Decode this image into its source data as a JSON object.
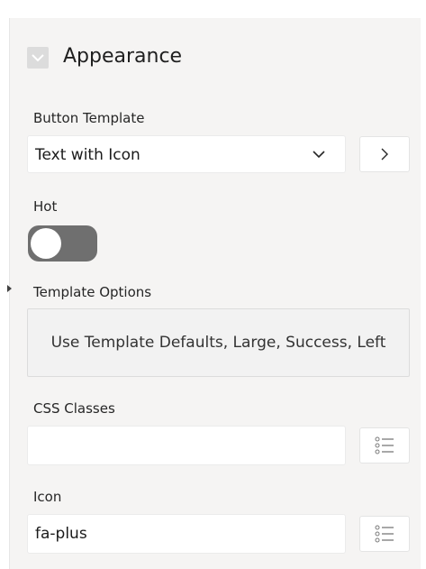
{
  "section": {
    "title": "Appearance"
  },
  "button_template": {
    "label": "Button Template",
    "value": "Text with Icon"
  },
  "hot": {
    "label": "Hot",
    "enabled": false
  },
  "template_options": {
    "label": "Template Options",
    "value": "Use Template Defaults, Large, Success, Left"
  },
  "css_classes": {
    "label": "CSS Classes",
    "value": ""
  },
  "icon": {
    "label": "Icon",
    "value": "fa-plus"
  },
  "icons": {
    "collapse": "chevron-down-icon",
    "select": "chevron-down-icon",
    "go": "chevron-right-icon",
    "list": "list-icon"
  },
  "colors": {
    "panel_bg": "#f5f4f3",
    "toggle_off": "#6f6f6f",
    "field_bg": "#ffffff"
  }
}
